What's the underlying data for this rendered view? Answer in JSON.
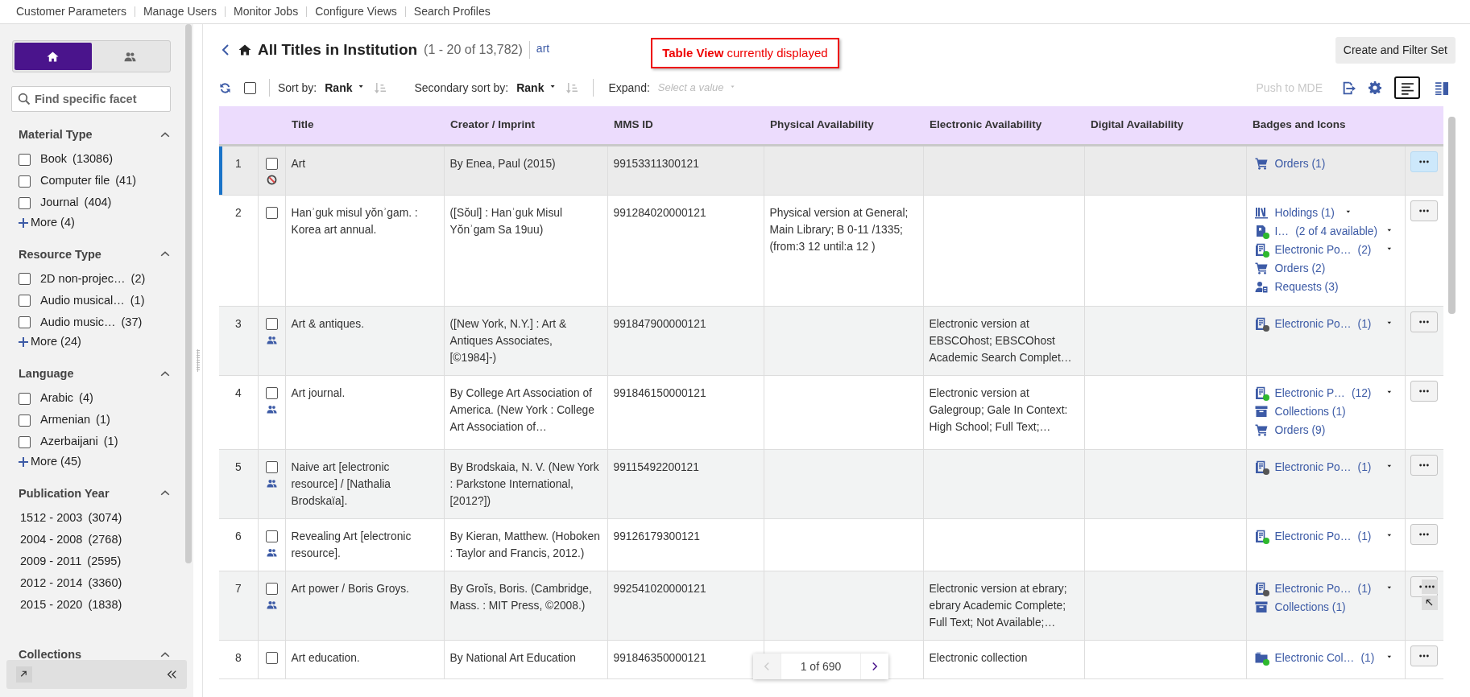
{
  "top_nav": [
    "Customer Parameters",
    "Manage Users",
    "Monitor Jobs",
    "Configure Views",
    "Search Profiles"
  ],
  "sidebar": {
    "toggles": [
      {
        "kind": "home",
        "selected": true
      },
      {
        "kind": "people",
        "selected": false
      }
    ],
    "search": {
      "placeholder": "Find specific facet"
    },
    "facets": [
      {
        "title": "Material Type",
        "expanded": true,
        "items": [
          {
            "kind": "checkbox",
            "label": "Book",
            "count": "(13086)",
            "checked": false
          },
          {
            "kind": "checkbox",
            "label": "Computer file",
            "count": "(41)",
            "checked": false
          },
          {
            "kind": "checkbox",
            "label": "Journal",
            "count": "(404)",
            "checked": false
          }
        ],
        "more": "More (4)"
      },
      {
        "title": "Resource Type",
        "expanded": true,
        "items": [
          {
            "kind": "checkbox",
            "label": "2D non-projec…",
            "count": "(2)",
            "checked": false
          },
          {
            "kind": "checkbox",
            "label": "Audio musical…",
            "count": "(1)",
            "checked": false
          },
          {
            "kind": "checkbox",
            "label": "Audio music…",
            "count": "(37)",
            "checked": false
          }
        ],
        "more": "More (24)"
      },
      {
        "title": "Language",
        "expanded": true,
        "items": [
          {
            "kind": "checkbox",
            "label": "Arabic",
            "count": "(4)",
            "checked": false
          },
          {
            "kind": "checkbox",
            "label": "Armenian",
            "count": "(1)",
            "checked": false
          },
          {
            "kind": "checkbox",
            "label": "Azerbaijani",
            "count": "(1)",
            "checked": false
          }
        ],
        "more": "More (45)"
      },
      {
        "title": "Publication Year",
        "expanded": true,
        "items": [
          {
            "kind": "link",
            "label": "1512 - 2003",
            "count": "(3074)"
          },
          {
            "kind": "link",
            "label": "2004 - 2008",
            "count": "(2768)"
          },
          {
            "kind": "link",
            "label": "2009 - 2011",
            "count": "(2595)"
          },
          {
            "kind": "link",
            "label": "2012 - 2014",
            "count": "(3360)"
          },
          {
            "kind": "link",
            "label": "2015 - 2020",
            "count": "(1838)"
          }
        ]
      },
      {
        "title": "Collections",
        "expanded": true
      }
    ]
  },
  "header": {
    "title": "All Titles in Institution",
    "range": "(1 - 20 of 13,782)",
    "query": "art",
    "notice": "**Table View** currently displayed",
    "action": "Create and Filter Set"
  },
  "toolbar": {
    "select_all": false,
    "sort_label": "Sort by:",
    "sort_value": "Rank",
    "secondary_label": "Secondary sort by:",
    "secondary_value": "Rank",
    "expand_label": "Expand:",
    "expand_placeholder": "Select a value",
    "push": {
      "label": "Push to MDE",
      "disabled": true
    },
    "views": [
      {
        "kind": "list",
        "selected": true
      },
      {
        "kind": "split",
        "selected": false
      }
    ]
  },
  "table": {
    "columns": [
      "Title",
      "Creator / Imprint",
      "MMS ID",
      "Physical Availability",
      "Electronic Availability",
      "Digital Availability",
      "Badges and Icons"
    ],
    "rows": [
      {
        "number": "1",
        "selected": true,
        "checked": false,
        "kind": "suppressed",
        "title": "Art",
        "creator": "By Enea, Paul (2015)",
        "mms_id": "99153311300121",
        "badges": [
          {
            "kind": "cart",
            "text": "Orders (1)",
            "dropdown": false
          }
        ]
      },
      {
        "number": "2",
        "selected": false,
        "checked": false,
        "kind": "plain",
        "title": "Hanʾguk misul yŏnʾgam. : Korea art annual.",
        "creator": "([Sŏul] : Hanʾguk Misul Yŏnʾgam Sa 19uu)",
        "mms_id": "991284020000121",
        "physical": "Physical version at General; Main Library; B 0-11 /1335; (from:3 12 until:a 12 )",
        "badges": [
          {
            "kind": "holdings",
            "text": "Holdings (1)",
            "dropdown": true
          },
          {
            "kind": "item",
            "text": "I…",
            "count": "(2 of 4 available)",
            "color": "#2eb82e",
            "dropdown": true
          },
          {
            "kind": "portfolio",
            "text": "Electronic Po…",
            "count": "(2)",
            "color": "#2eb82e",
            "dropdown": true
          },
          {
            "kind": "cart",
            "text": "Orders (2)",
            "dropdown": false
          },
          {
            "kind": "request",
            "text": "Requests (3)",
            "dropdown": false
          }
        ]
      },
      {
        "number": "3",
        "selected": false,
        "checked": false,
        "kind": "shared",
        "title": "Art & antiques.",
        "creator": "([New York, N.Y.] : Art & Antiques Associates, [©1984]-)",
        "mms_id": "991847900000121",
        "electronic": "Electronic version at EBSCOhost; EBSCOhost Academic Search Complet…",
        "badges": [
          {
            "kind": "portfolio",
            "text": "Electronic Po…",
            "count": "(1)",
            "color": "#555555",
            "dropdown": true
          }
        ]
      },
      {
        "number": "4",
        "selected": false,
        "checked": false,
        "kind": "shared",
        "title": "Art journal.",
        "creator": "By College Art Association of America. (New York : College Art Association of…",
        "mms_id": "991846150000121",
        "electronic": "Electronic version at Galegroup; Gale In Context: High School; Full Text;…",
        "badges": [
          {
            "kind": "portfolio",
            "text": "Electronic P…",
            "count": "(12)",
            "color": "#2eb82e",
            "dropdown": true
          },
          {
            "kind": "collection",
            "text": "Collections (1)",
            "dropdown": false
          },
          {
            "kind": "cart",
            "text": "Orders (9)",
            "dropdown": false
          }
        ]
      },
      {
        "number": "5",
        "selected": false,
        "checked": false,
        "kind": "shared",
        "title": "Naive art [electronic resource] / [Nathalia Brodskaïa].",
        "creator": "By Brodskaia, N. V. (New York : Parkstone International, [2012?])",
        "mms_id": "99115492200121",
        "badges": [
          {
            "kind": "portfolio",
            "text": "Electronic Po…",
            "count": "(1)",
            "color": "#555555",
            "dropdown": true
          }
        ]
      },
      {
        "number": "6",
        "selected": false,
        "checked": false,
        "kind": "shared",
        "title": "Revealing Art [electronic resource].",
        "creator": "By Kieran, Matthew. (Hoboken : Taylor and Francis, 2012.)",
        "mms_id": "99126179300121",
        "badges": [
          {
            "kind": "portfolio",
            "text": "Electronic Po…",
            "count": "(1)",
            "color": "#2eb82e",
            "dropdown": true
          }
        ]
      },
      {
        "number": "7",
        "selected": false,
        "checked": false,
        "kind": "shared",
        "title": "Art power / Boris Groys.",
        "creator": "By Groĭs, Boris. (Cambridge, Mass. : MIT Press, ©2008.)",
        "mms_id": "992541020000121",
        "electronic": "Electronic version at ebrary; ebrary Academic Complete; Full Text; Not Available;…",
        "badges": [
          {
            "kind": "portfolio",
            "text": "Electronic Po…",
            "count": "(1)",
            "color": "#555555",
            "dropdown": true
          },
          {
            "kind": "collection",
            "text": "Collections (1)",
            "dropdown": false
          }
        ]
      },
      {
        "number": "8",
        "selected": false,
        "checked": false,
        "kind": "plain",
        "title": "Art education.",
        "creator": "By National Art Education",
        "mms_id": "991846350000121",
        "electronic": "Electronic collection",
        "badges": [
          {
            "kind": "folder",
            "text": "Electronic Col…",
            "count": "(1)",
            "color": "#2eb82e",
            "dropdown": true
          }
        ]
      }
    ]
  },
  "pager": {
    "text": "1 of 690",
    "prev_disabled": true
  }
}
